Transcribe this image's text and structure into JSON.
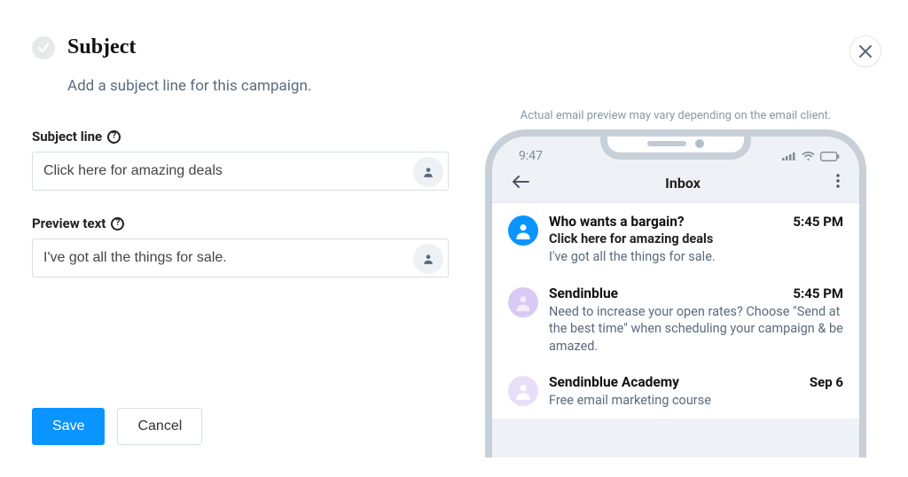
{
  "section": {
    "title": "Subject",
    "subtitle": "Add a subject line for this campaign."
  },
  "fields": {
    "subject": {
      "label": "Subject line",
      "value": "Click here for amazing deals"
    },
    "preview": {
      "label": "Preview text",
      "value": "I've got all the things for sale."
    }
  },
  "actions": {
    "save": "Save",
    "cancel": "Cancel"
  },
  "right": {
    "note": "Actual email preview may vary depending on the email client.",
    "clock": "9:47",
    "inbox_label": "Inbox"
  },
  "emails": [
    {
      "sender": "Who wants a bargain?",
      "time": "5:45 PM",
      "subject": "Click here for amazing deals",
      "preview": "I've got all the things for sale.",
      "avatar": "blue"
    },
    {
      "sender": "Sendinblue",
      "time": "5:45 PM",
      "subject": "",
      "preview": "Need to increase your open rates? Choose \"Send at the best time\" when scheduling your campaign & be amazed.",
      "avatar": "lilac"
    },
    {
      "sender": "Sendinblue Academy",
      "time": "Sep 6",
      "subject": "",
      "preview": "Free email marketing course",
      "avatar": "lilac2"
    }
  ]
}
